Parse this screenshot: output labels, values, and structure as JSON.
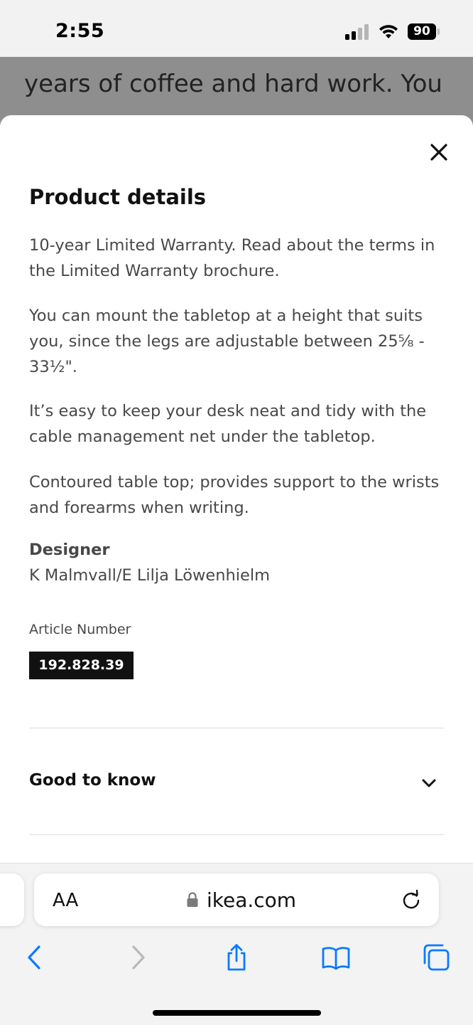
{
  "status_bar": {
    "time": "2:55",
    "battery": "90"
  },
  "background_page": {
    "visible_text": "years of coffee and hard work. You"
  },
  "product_details": {
    "title": "Product details",
    "paragraphs": [
      "10-year Limited Warranty. Read about the terms in the Limited Warranty brochure.",
      "You can mount the tabletop at a height that suits you, since the legs are adjustable between 25⅝ - 33½\".",
      "It’s easy to keep your desk neat and tidy with the cable management net under the tabletop.",
      "Contoured table top; provides support to the wrists and forearms when writing."
    ],
    "designer_label": "Designer",
    "designer_name": "K Malmvall/E Lilja Löwenhielm",
    "article_number_label": "Article Number",
    "article_number": "192.828.39",
    "good_to_know_label": "Good to know"
  },
  "browser": {
    "text_size_label": "AA",
    "domain": "ikea.com"
  },
  "colors": {
    "accent_blue": "#0a7aff",
    "disabled_gray": "#b8b8bd",
    "article_badge_bg": "#111111",
    "body_text": "#484848"
  },
  "icons": {
    "close": "close-icon",
    "chevron": "chevron-down-icon",
    "lock": "lock-icon",
    "reload": "reload-icon",
    "back": "back-arrow-icon",
    "forward": "forward-arrow-icon",
    "share": "share-icon",
    "bookmarks": "bookmarks-icon",
    "tabs": "tabs-icon"
  }
}
